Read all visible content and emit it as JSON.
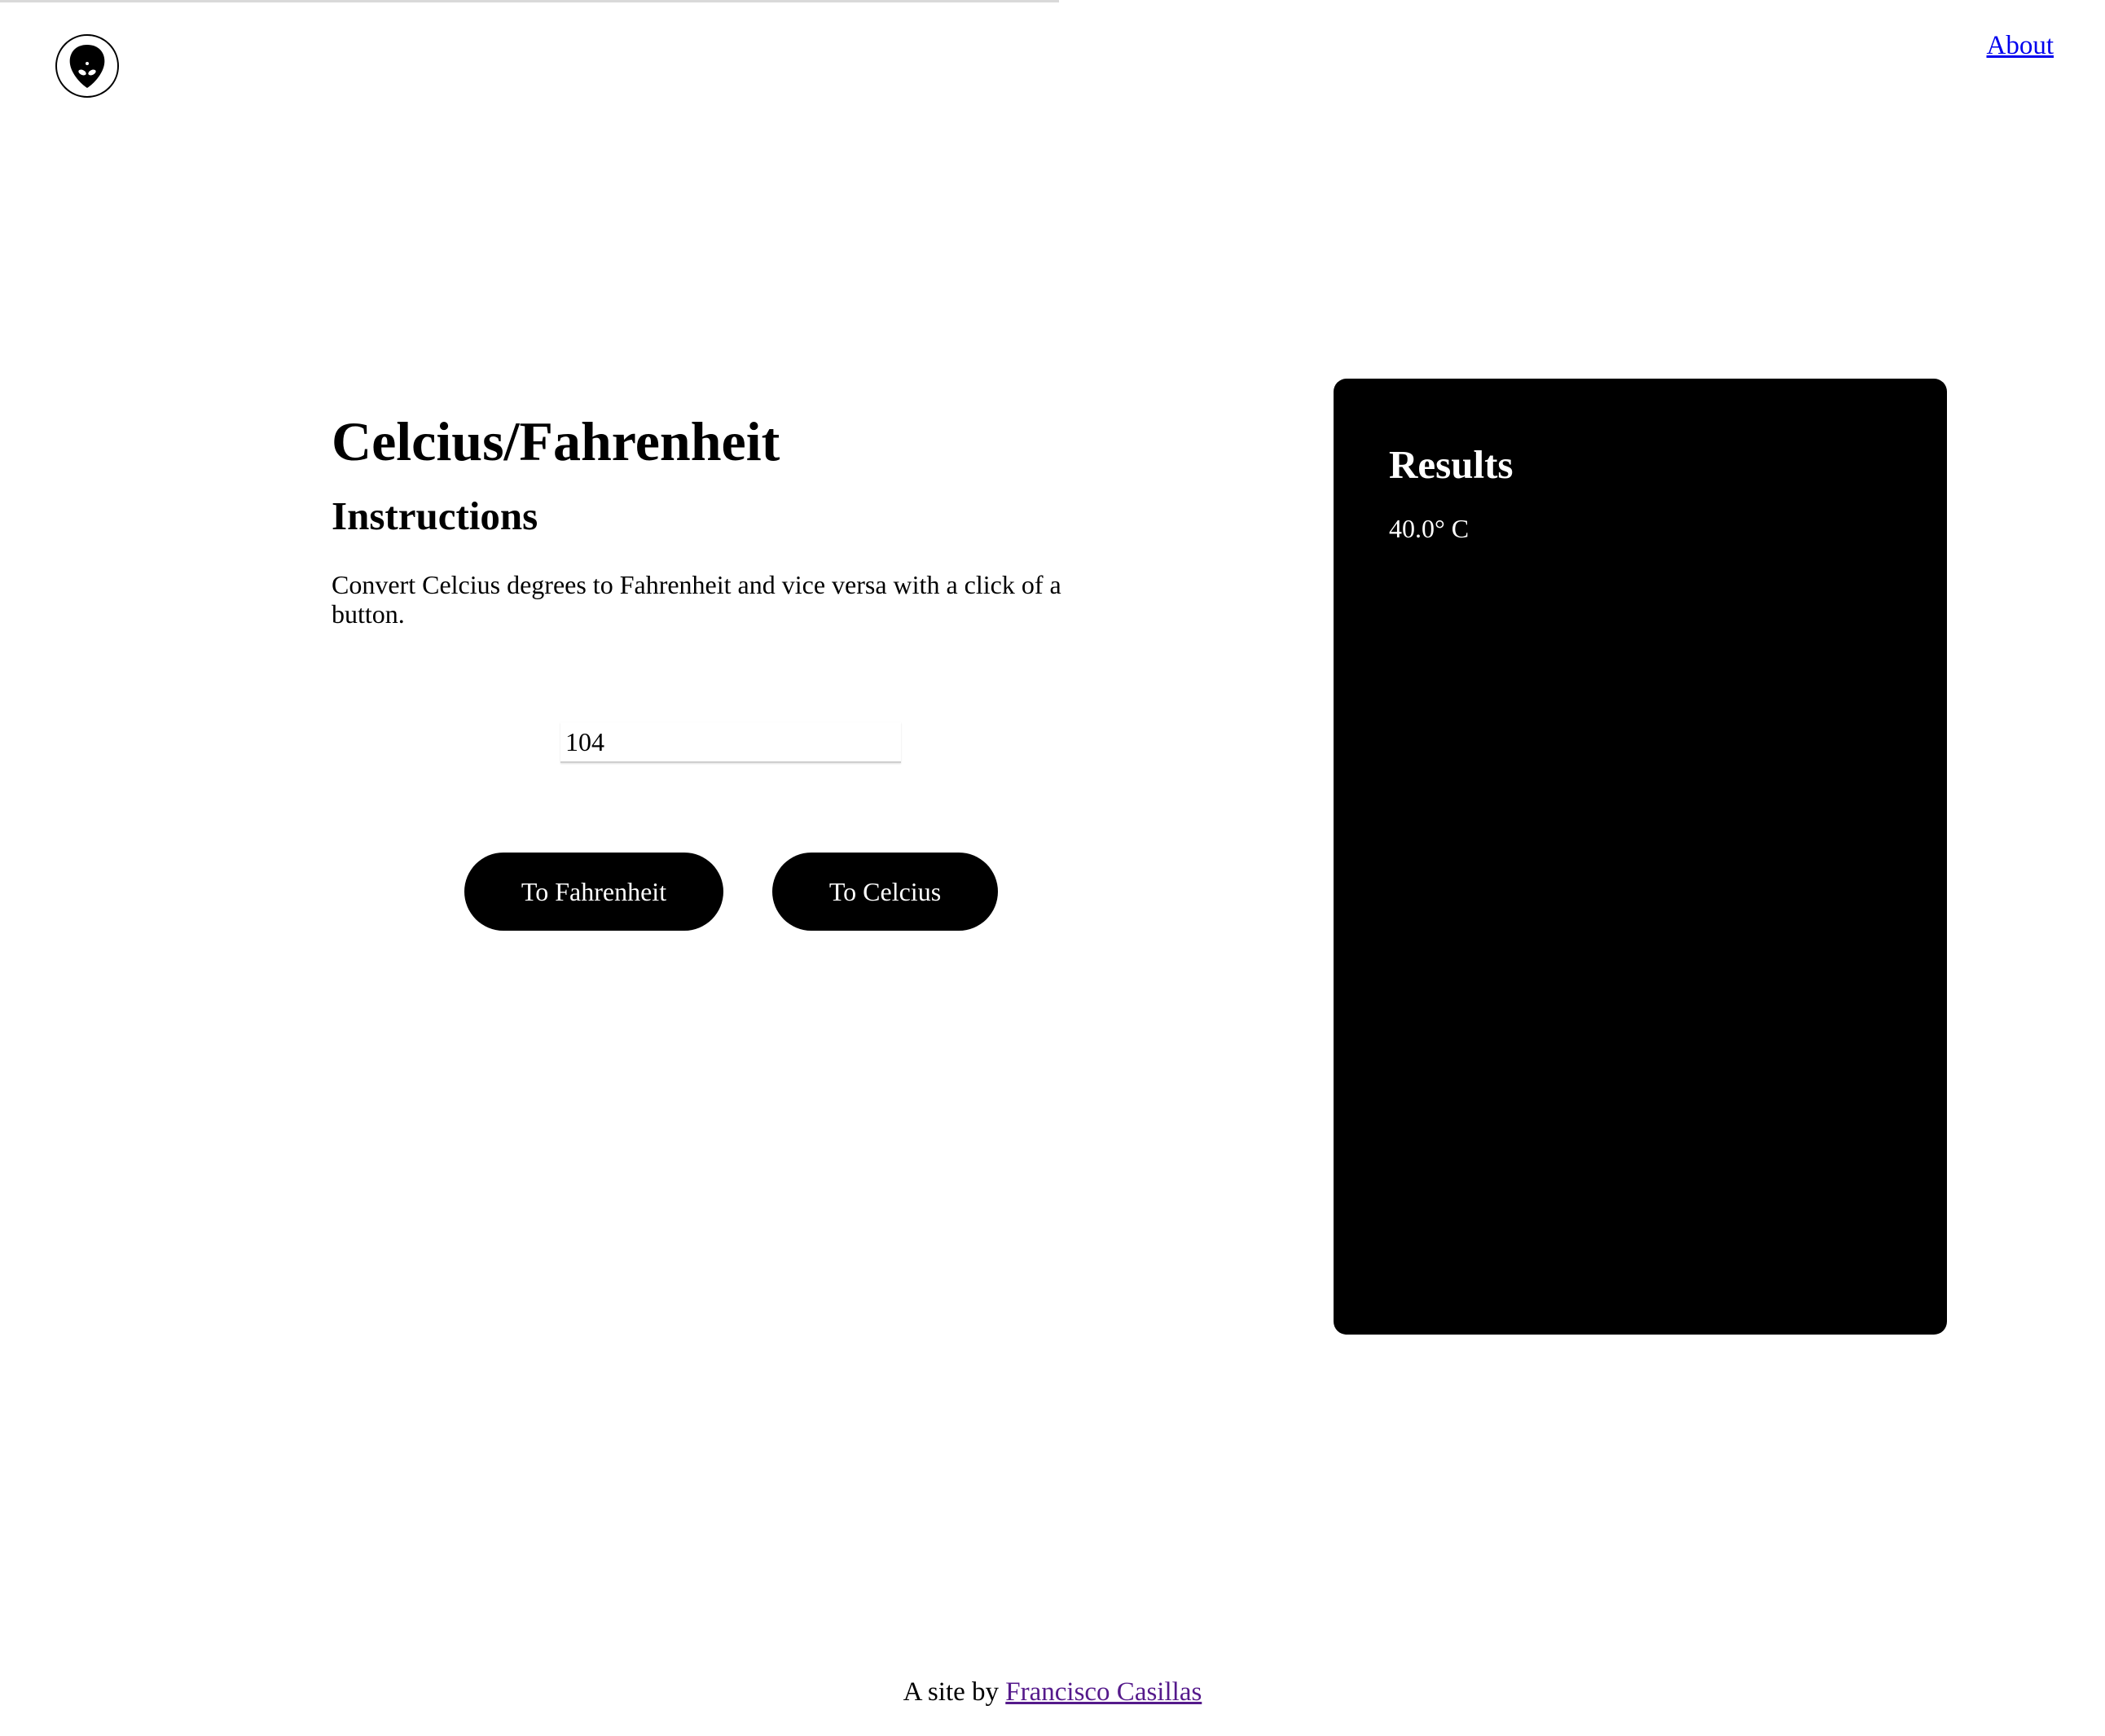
{
  "header": {
    "logo_icon": "alien-head-icon",
    "about_label": "About"
  },
  "main": {
    "title": "Celcius/Fahrenheit",
    "instructions_heading": "Instructions",
    "instructions_text": "Convert Celcius degrees to Fahrenheit and vice versa with a click of a button.",
    "input_value": "104",
    "to_fahrenheit_label": "To Fahrenheit",
    "to_celcius_label": "To Celcius"
  },
  "results": {
    "heading": "Results",
    "value": "40.0° C"
  },
  "footer": {
    "prefix": "A site by",
    "author": "Francisco Casillas"
  },
  "colors": {
    "background": "#ffffff",
    "card": "#000000",
    "link": "#0000ee",
    "visited_link": "#551a8b"
  }
}
